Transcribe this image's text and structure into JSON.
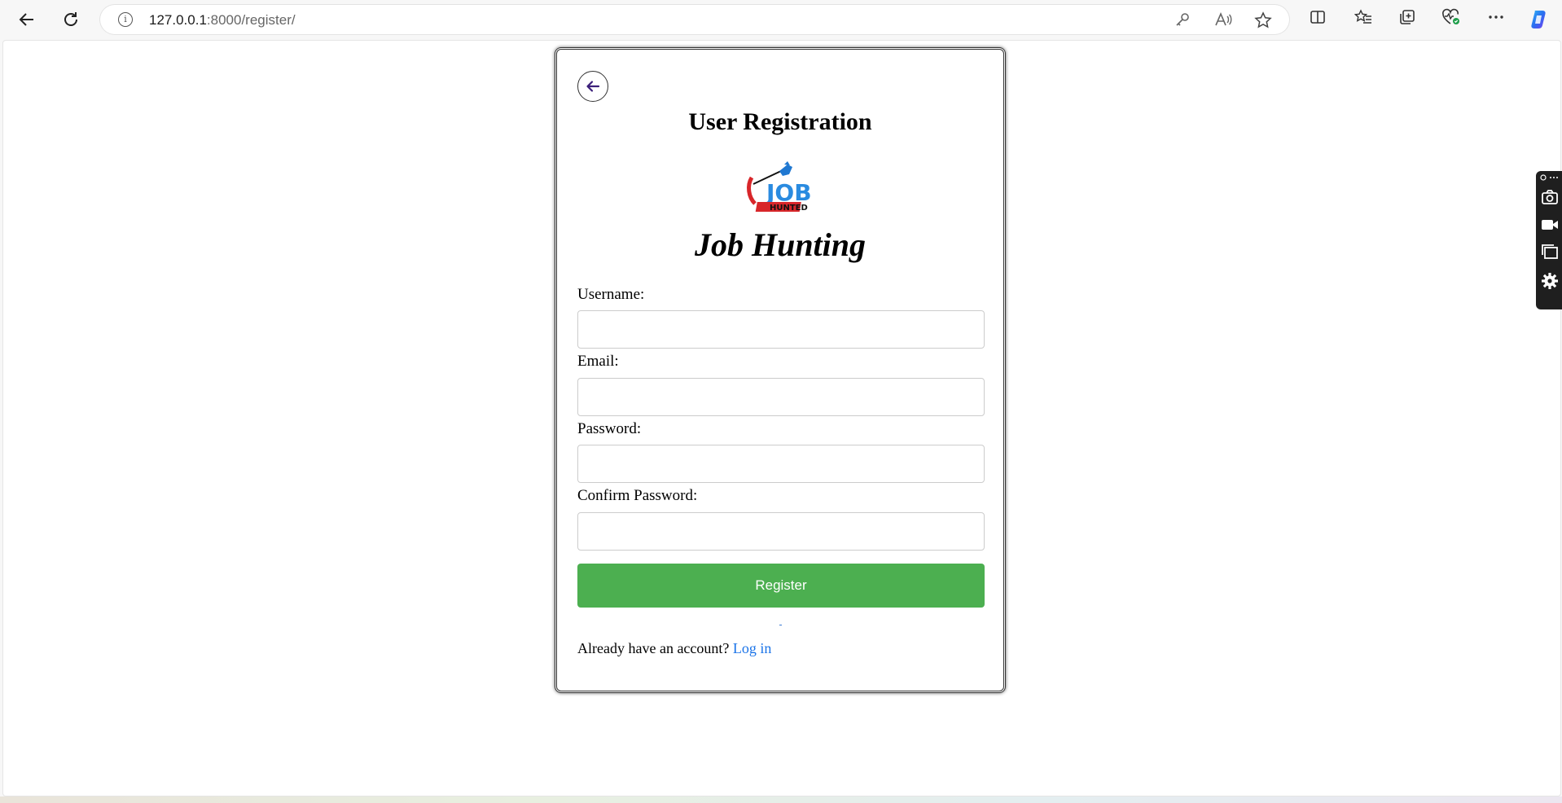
{
  "browser": {
    "url_host": "127.0.0.1",
    "url_path": ":8000/register/",
    "info_glyph": "i"
  },
  "page": {
    "title": "User Registration",
    "brand": "Job Hunting",
    "logo_text": "JOB",
    "logo_subtext": "HUNTED",
    "fields": [
      {
        "label": "Username:",
        "value": "",
        "type": "text"
      },
      {
        "label": "Email:",
        "value": "",
        "type": "email"
      },
      {
        "label": "Password:",
        "value": "",
        "type": "password"
      },
      {
        "label": "Confirm Password:",
        "value": "",
        "type": "password"
      }
    ],
    "register_label": "Register",
    "footer_text": "Already have an account?",
    "login_link": "Log in"
  },
  "colors": {
    "register_button": "#4caf50",
    "link": "#1a73e8",
    "back_arrow": "#3b1f7a"
  }
}
